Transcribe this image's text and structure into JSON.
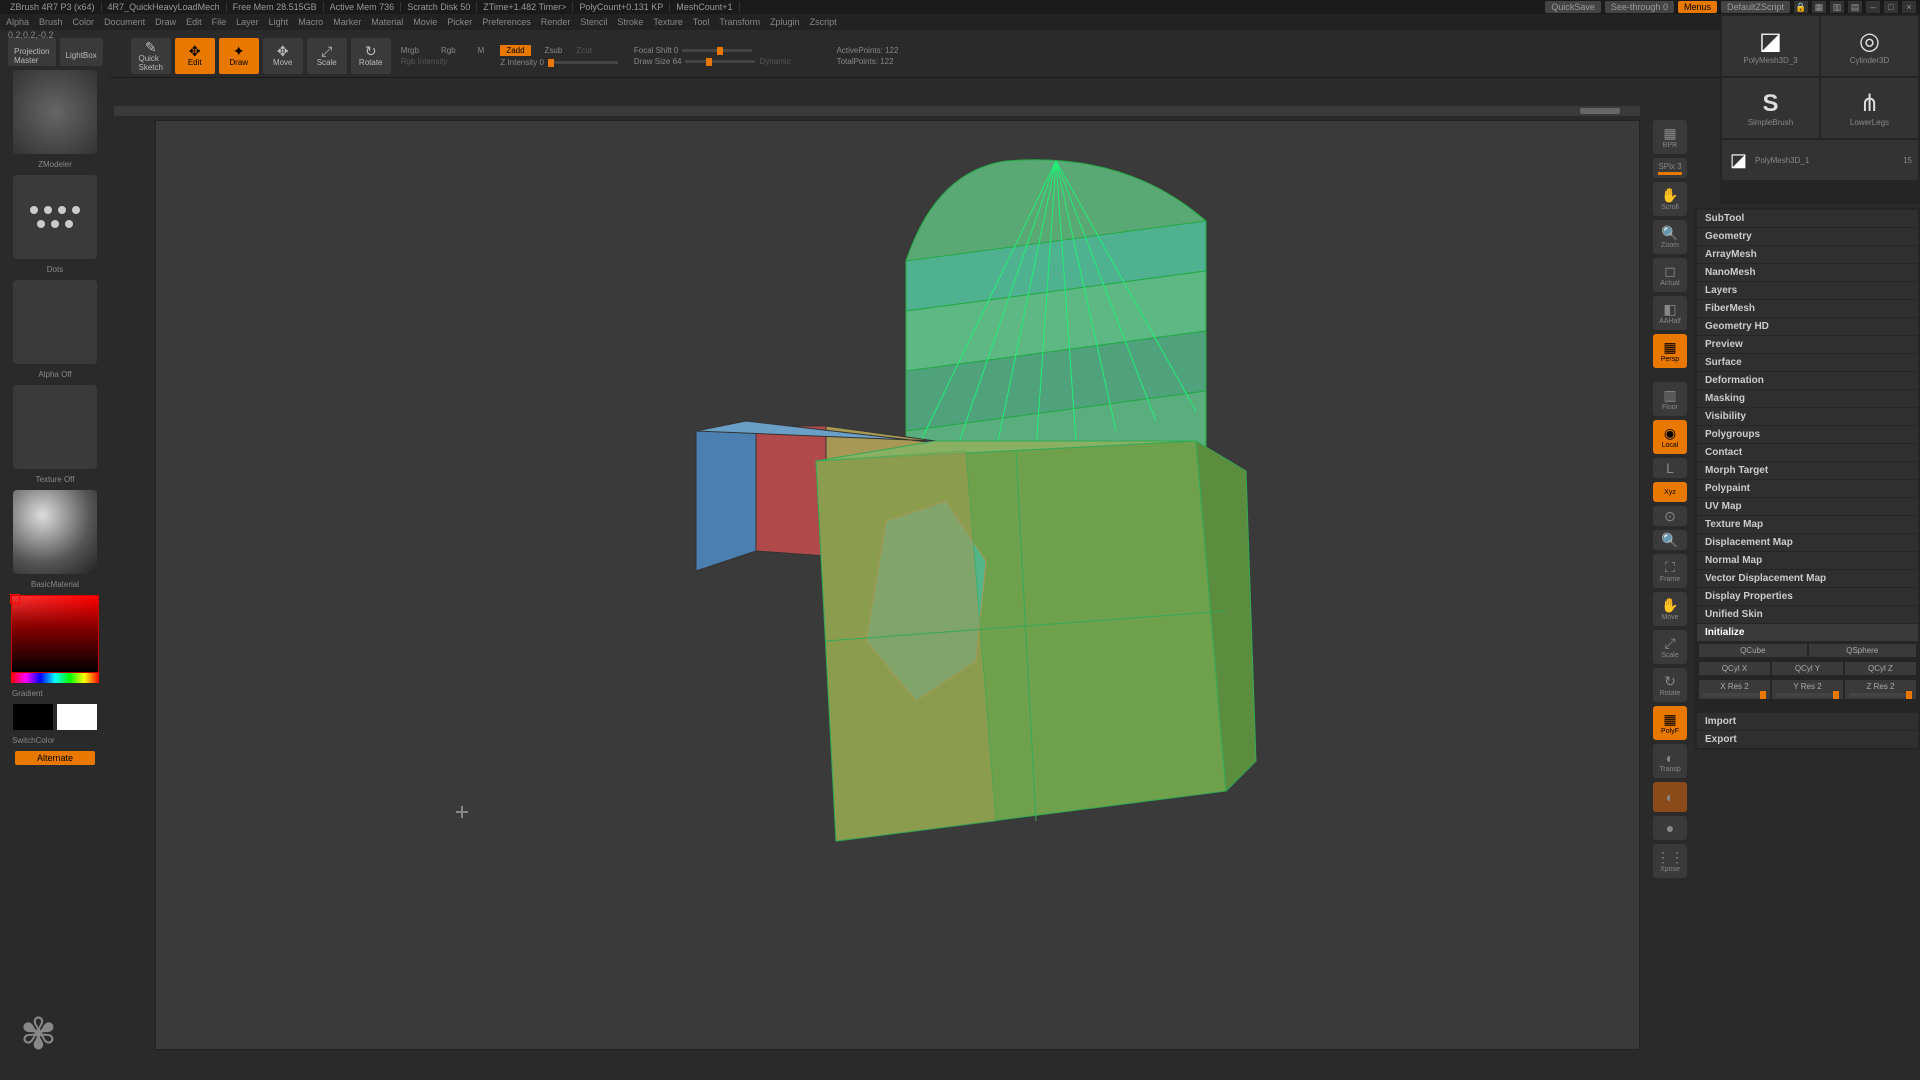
{
  "title": {
    "segments": [
      "ZBrush 4R7 P3 (x64)",
      "4R7_QuickHeavyLoadMech",
      "Free Mem 28.515GB",
      "Active Mem 736",
      "Scratch Disk 50",
      "ZTime+1.482 Timer>",
      "PolyCount+0.131 KP",
      "MeshCount+1"
    ],
    "quicksave": "QuickSave",
    "see_through": "See-through  0",
    "menus": "Menus",
    "script": "DefaultZScript"
  },
  "menus": [
    "Alpha",
    "Brush",
    "Color",
    "Document",
    "Draw",
    "Edit",
    "File",
    "Layer",
    "Light",
    "Macro",
    "Marker",
    "Material",
    "Movie",
    "Picker",
    "Preferences",
    "Render",
    "Stencil",
    "Stroke",
    "Texture",
    "Tool",
    "Transform",
    "Zplugin",
    "Zscript"
  ],
  "status_corner": "0.2,0.2,-0.2",
  "ribbon": {
    "projection_master": "Projection\nMaster",
    "lightbox": "LightBox",
    "quick_sketch": "Quick\nSketch",
    "edit": "Edit",
    "draw": "Draw",
    "move": "Move",
    "scale": "Scale",
    "rotate": "Rotate",
    "mrgb": "Mrgb",
    "rgb": "Rgb",
    "m": "M",
    "rgb_intensity": "Rgb Intensity",
    "zadd": "Zadd",
    "zsub": "Zsub",
    "zcut": "Zcut",
    "z_intensity": "Z Intensity 0",
    "focal_shift": "Focal Shift 0",
    "draw_size": "Draw Size 64",
    "dynamic": "Dynamic",
    "active_points": "ActivePoints: 122",
    "total_points": "TotalPoints: 122"
  },
  "left": {
    "zmodeler": "ZModeler",
    "dots": "Dots",
    "alpha_off": "Alpha Off",
    "texture_off": "Texture Off",
    "material": "BasicMaterial",
    "gradient": "Gradient",
    "switch_color": "SwitchColor",
    "alternate": "Alternate"
  },
  "right_tools": {
    "cylinder3d": "Cylinder3D",
    "polymesh3d_3": "PolyMesh3D_3",
    "lowerlegs": "LowerLegs",
    "simplebrush": "SimpleBrush",
    "polymesh3d_1": "PolyMesh3D_1",
    "count": "15"
  },
  "side_icons": {
    "bpr": "BPR",
    "spix": "SPix 3",
    "scroll": "Scroll",
    "zoom": "Zoom",
    "actual": "Actual",
    "aahalf": "AAHalf",
    "persp": "Persp",
    "floor": "Floor",
    "local": "Local",
    "xyz": "Xyz",
    "frame": "Frame",
    "move": "Move",
    "scale": "Scale",
    "rotate": "Rotate",
    "linefill": "Line Fill",
    "polyf": "PolyF",
    "transp": "Transp",
    "ghost": "Ghost",
    "solo": "Solo",
    "xpose": "Xpose"
  },
  "accordion": [
    "SubTool",
    "Geometry",
    "ArrayMesh",
    "NanoMesh",
    "Layers",
    "FiberMesh",
    "Geometry HD",
    "Preview",
    "Surface",
    "Deformation",
    "Masking",
    "Visibility",
    "Polygroups",
    "Contact",
    "Morph Target",
    "Polypaint",
    "UV Map",
    "Texture Map",
    "Displacement Map",
    "Normal Map",
    "Vector Displacement Map",
    "Display Properties",
    "Unified Skin"
  ],
  "initialize": {
    "label": "Initialize",
    "qcube": "QCube",
    "qsphere": "QSphere",
    "qcyl_x": "QCyl X",
    "qcyl_y": "QCyl Y",
    "qcyl_z": "QCyl Z",
    "xres": "X Res 2",
    "yres": "Y Res 2",
    "zres": "Z Res 2"
  },
  "import_label": "Import",
  "export_label": "Export",
  "chart_data": {
    "type": "3d-mesh",
    "description": "Polygroup-colored low-poly mesh: green cube base with bevelled edges, rounded cylindrical turret on top (teal/green stripes), rectangular horizontal bar (blue/red/olive segments) intersecting left side; hexagonal inset face front",
    "active_points": 122,
    "total_points": 122
  }
}
